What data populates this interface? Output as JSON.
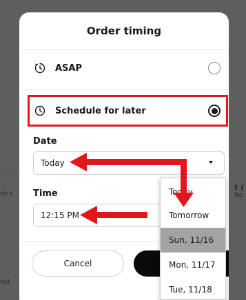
{
  "background": {
    "left_fragment_1": "sh e",
    "left_fragment_2": "out",
    "right_fragment_1": "t (",
    "right_fragment_2": "fte"
  },
  "modal": {
    "title": "Order timing",
    "options": {
      "asap_label": "ASAP",
      "schedule_label": "Schedule for later",
      "selected": "Schedule for later"
    },
    "date": {
      "label": "Date",
      "value": "Today"
    },
    "time": {
      "label": "Time",
      "value": "12:15 PM"
    },
    "cancel_label": "Cancel",
    "primary_label": ""
  },
  "dropdown": {
    "items": [
      "Today",
      "Tomorrow",
      "Sun, 11/16",
      "Mon, 11/17",
      "Tue, 11/18"
    ],
    "highlighted": "Sun, 11/16"
  },
  "colors": {
    "annotation_red": "#e3161b",
    "primary_button": "#0a0a0a",
    "overlay": "#5e5e5e",
    "dropdown_highlight": "#a3a3a3"
  },
  "icons": {
    "option_icon": "clock-icon",
    "select_caret": "caret-down-icon",
    "radio": "radio-icon"
  }
}
